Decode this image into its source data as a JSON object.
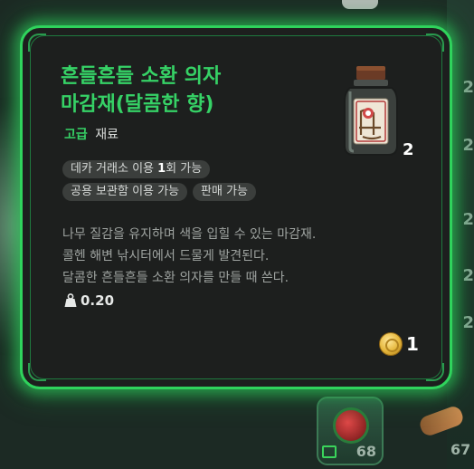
{
  "background": {
    "right_numbers": [
      "2",
      "2",
      "2",
      "2",
      "2"
    ],
    "slots": [
      {
        "count": "68"
      },
      {
        "count": "67"
      }
    ]
  },
  "tooltip": {
    "title_lines": [
      "흔들흔들 소환 의자",
      "마감재(달콤한 향)"
    ],
    "grade": "고급",
    "category": "재료",
    "item_count": "2",
    "tags": [
      {
        "prefix": "데카 거래소 이용 ",
        "highlight": "1",
        "suffix": "회 가능"
      },
      {
        "text": "공용 보관함 이용 가능"
      },
      {
        "text": "판매 가능"
      }
    ],
    "description_lines": [
      "나무 질감을 유지하며 색을 입힐 수 있는 마감재.",
      "콜헨 해변 낚시터에서 드물게 발견된다.",
      "달콤한 흔들흔들 소환 의자를 만들 때 쓴다."
    ],
    "weight": "0.20",
    "price": "1"
  },
  "colors": {
    "border_glow": "#2fd35c",
    "title": "#36d266",
    "panel_bg": "#1d1f1e"
  },
  "icons": {
    "item": "jar-icon",
    "weight": "weight-icon",
    "currency": "gold-coin-icon"
  }
}
